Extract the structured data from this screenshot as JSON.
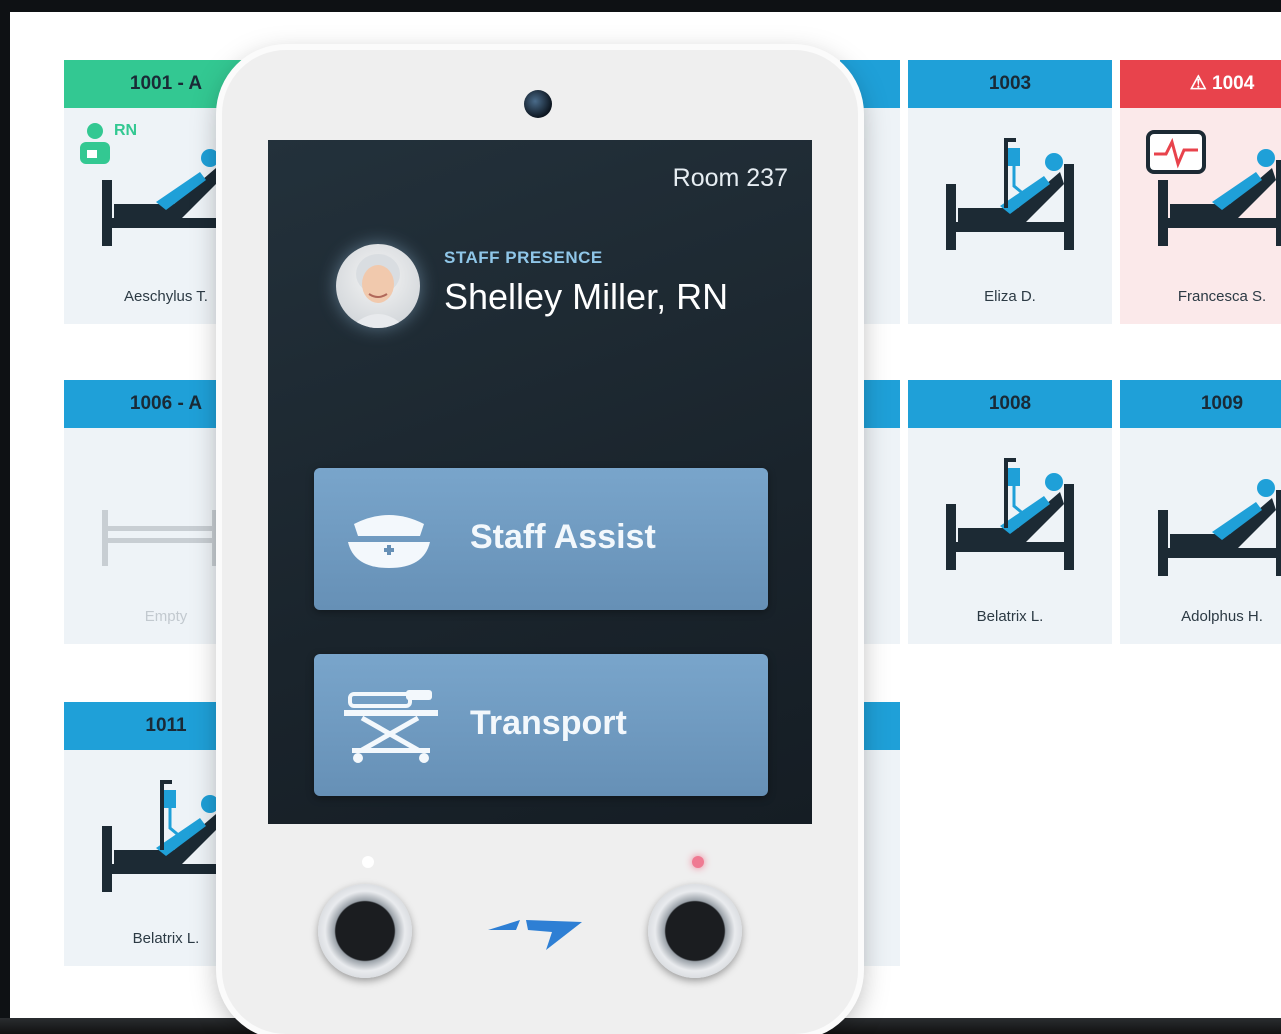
{
  "tiles": [
    {
      "id": "1001 - A",
      "patient": "Aeschylus T.",
      "status": "green",
      "badge": "RN"
    },
    {
      "id": "1003",
      "patient": "Eliza D.",
      "status": "blue"
    },
    {
      "id": "1004",
      "patient": "Francesca S.",
      "status": "red",
      "alert": "⚠"
    },
    {
      "id": "1006 - A",
      "patient": "Empty",
      "status": "empty"
    },
    {
      "id": "1008",
      "patient": "Belatrix L.",
      "status": "blue"
    },
    {
      "id": "1009",
      "patient": "Adolphus H.",
      "status": "blue"
    },
    {
      "id": "1011",
      "patient": "Belatrix L.",
      "status": "blue"
    }
  ],
  "device": {
    "room": "Room 237",
    "presence_label": "STAFF PRESENCE",
    "staff_name": "Shelley Miller, RN",
    "buttons": [
      {
        "label": "Staff Assist",
        "icon": "nurse-cap-icon"
      },
      {
        "label": "Transport",
        "icon": "stretcher-icon"
      }
    ],
    "led_left_color": "#ffffff",
    "led_right_color": "#ef7a92"
  },
  "colors": {
    "green": "#33c892",
    "blue": "#1fa0d8",
    "red": "#e8434c"
  }
}
